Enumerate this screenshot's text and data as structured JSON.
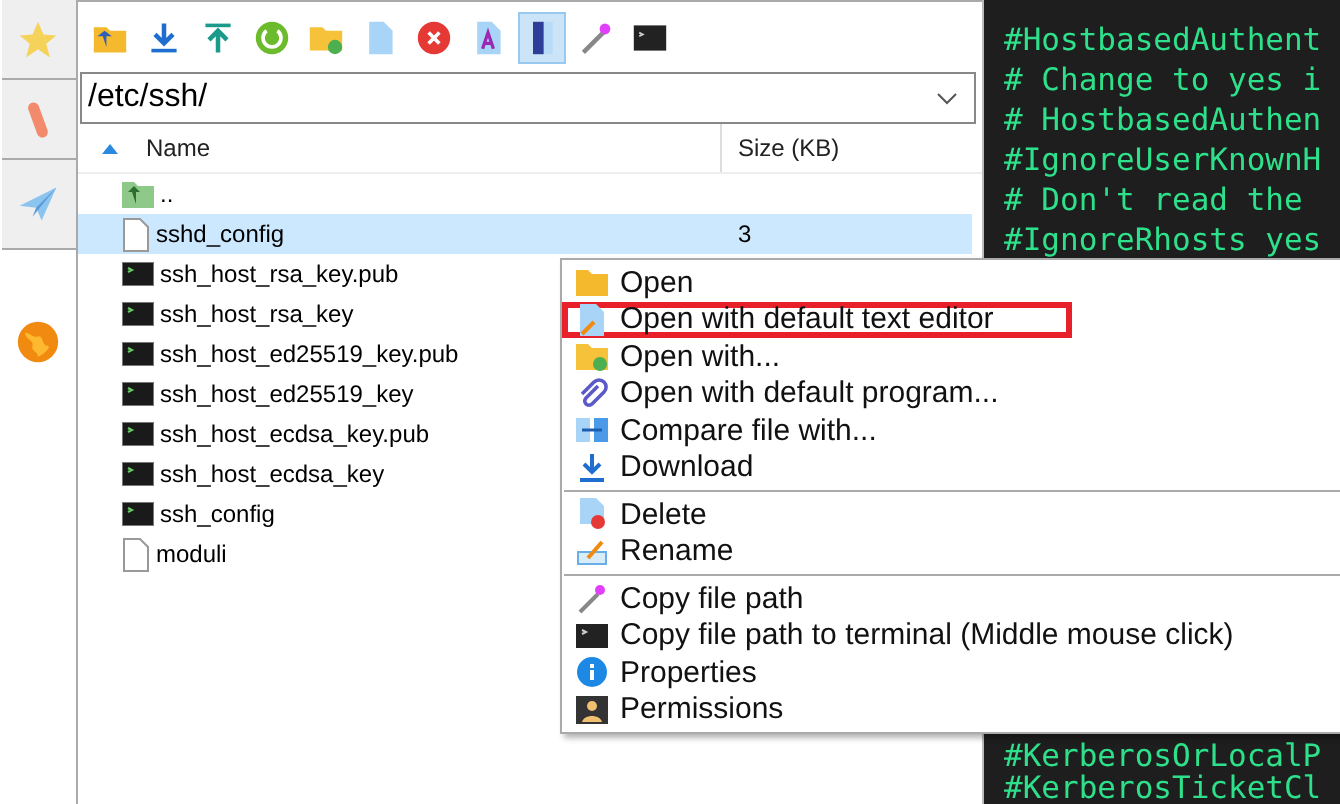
{
  "toolbar": [
    {
      "on": false
    },
    {
      "on": false
    },
    {
      "on": false
    },
    {
      "on": false
    },
    {
      "on": false
    },
    {
      "on": false
    },
    {
      "on": false
    },
    {
      "on": false
    },
    {
      "on": true
    },
    {
      "on": false
    },
    {
      "on": false
    }
  ],
  "path": {
    "value": "/etc/ssh/"
  },
  "columns": [
    {
      "label": "Name",
      "sorted": true
    },
    {
      "label": "Size (KB)",
      "sorted": false
    }
  ],
  "files": [
    {
      "name": "..",
      "kind": "parent",
      "selected": false
    },
    {
      "name": "sshd_config",
      "size": "3",
      "kind": "document",
      "selected": true
    },
    {
      "name": "ssh_host_rsa_key.pub",
      "kind": "terminal",
      "selected": false
    },
    {
      "name": "ssh_host_rsa_key",
      "kind": "terminal",
      "selected": false
    },
    {
      "name": "ssh_host_ed25519_key.pub",
      "kind": "terminal",
      "selected": false
    },
    {
      "name": "ssh_host_ed25519_key",
      "kind": "terminal",
      "selected": false
    },
    {
      "name": "ssh_host_ecdsa_key.pub",
      "kind": "terminal",
      "selected": false
    },
    {
      "name": "ssh_host_ecdsa_key",
      "kind": "terminal",
      "selected": false
    },
    {
      "name": "ssh_config",
      "kind": "terminal",
      "selected": false
    },
    {
      "name": "moduli",
      "kind": "document",
      "selected": false
    }
  ],
  "terminal": {
    "top_lines": [
      "#HostbasedAuthent",
      "# Change to yes i",
      "# HostbasedAuthen",
      "#IgnoreUserKnownH",
      "# Don't read the",
      "#IgnoreRhosts yes"
    ],
    "bottom_lines": [
      "#KerberosOrLocalP",
      "#KerberosTicketCl"
    ]
  },
  "context_menu": [
    [
      {
        "label": "Open",
        "annotated": false
      },
      {
        "label": "Open with default text editor",
        "annotated": true
      },
      {
        "label": "Open with...",
        "annotated": false
      },
      {
        "label": "Open with default program...",
        "annotated": false
      },
      {
        "label": "Compare file with...",
        "annotated": false
      },
      {
        "label": "Download",
        "annotated": false
      }
    ],
    [
      {
        "label": "Delete",
        "annotated": false
      },
      {
        "label": "Rename",
        "annotated": false
      }
    ],
    [
      {
        "label": "Copy file path",
        "annotated": false
      },
      {
        "label": "Copy file path to terminal (Middle mouse click)",
        "annotated": false
      },
      {
        "label": "Properties",
        "annotated": false
      },
      {
        "label": "Permissions",
        "annotated": false
      }
    ]
  ]
}
